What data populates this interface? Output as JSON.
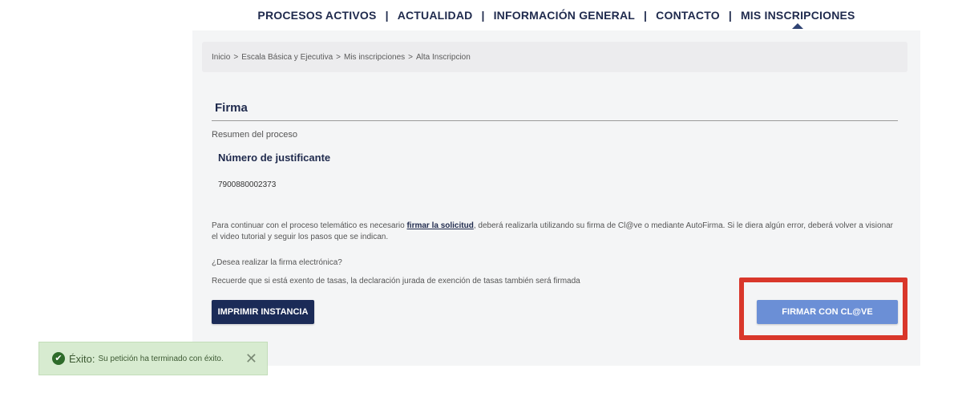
{
  "nav": {
    "items": [
      {
        "label": "PROCESOS ACTIVOS"
      },
      {
        "label": "ACTUALIDAD"
      },
      {
        "label": "INFORMACIÓN GENERAL"
      },
      {
        "label": "CONTACTO"
      },
      {
        "label": "MIS INSCRIPCIONES"
      }
    ],
    "separator": "|"
  },
  "breadcrumb": {
    "items": [
      "Inicio",
      "Escala Básica y Ejecutiva",
      "Mis inscripciones",
      "Alta Inscripcion"
    ],
    "separator": ">"
  },
  "section": {
    "title": "Firma",
    "summary_label": "Resumen del proceso",
    "justificante_label": "Número de justificante",
    "justificante_value": "7900880002373"
  },
  "info": {
    "text_before": "Para continuar con el proceso telemático es necesario ",
    "link": "firmar la solicitud",
    "text_after": ", deberá realizarla utilizando su firma de Cl@ve o mediante AutoFirma. Si le diera algún error, deberá volver a visionar el video tutorial y seguir los pasos que se indican.",
    "question": "¿Desea realizar la firma electrónica?",
    "reminder": "Recuerde que si está exento de tasas, la declaración jurada de exención de tasas también será firmada"
  },
  "buttons": {
    "print": "IMPRIMIR INSTANCIA",
    "clave": "FIRMAR CON CL@VE"
  },
  "toast": {
    "icon": "check-circle-icon",
    "title": "Éxito:",
    "message": "Su petición ha terminado con éxito.",
    "close_glyph": "✕"
  },
  "colors": {
    "nav_text": "#1f2a4d",
    "print_button": "#1b2b57",
    "clave_button": "#6b8fd6",
    "highlight": "#d9372b",
    "toast_bg": "#d7ebd0"
  }
}
